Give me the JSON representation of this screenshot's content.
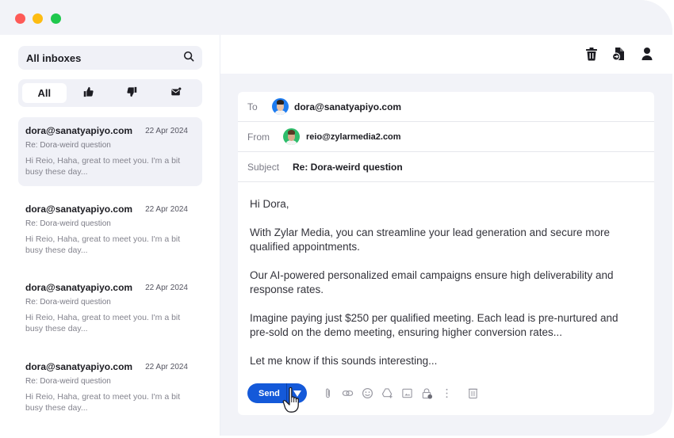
{
  "window": {
    "controls": [
      "close",
      "minimize",
      "maximize"
    ]
  },
  "sidebar": {
    "search": {
      "label": "All inboxes",
      "icon": "search-icon"
    },
    "filters": [
      {
        "label": "All",
        "icon": null,
        "active": true
      },
      {
        "label": "",
        "icon": "thumbs-up-icon",
        "active": false
      },
      {
        "label": "",
        "icon": "thumbs-down-icon",
        "active": false
      },
      {
        "label": "",
        "icon": "envelope-icon",
        "active": false
      }
    ],
    "mails": [
      {
        "from": "dora@sanatyapiyo.com",
        "date": "22 Apr 2024",
        "subject": "Re: Dora-weird question",
        "preview": "Hi Reio, Haha, great to meet you. I'm a bit busy these day...",
        "selected": true
      },
      {
        "from": "dora@sanatyapiyo.com",
        "date": "22 Apr 2024",
        "subject": "Re: Dora-weird question",
        "preview": "Hi Reio, Haha, great to meet you. I'm a bit busy these day...",
        "selected": false
      },
      {
        "from": "dora@sanatyapiyo.com",
        "date": "22 Apr 2024",
        "subject": "Re: Dora-weird question",
        "preview": "Hi Reio, Haha, great to meet you. I'm a bit busy these day...",
        "selected": false
      },
      {
        "from": "dora@sanatyapiyo.com",
        "date": "22 Apr 2024",
        "subject": "Re: Dora-weird question",
        "preview": "Hi Reio, Haha, great to meet you. I'm a bit busy these day...",
        "selected": false
      }
    ]
  },
  "header": {
    "icons": [
      "trash-icon",
      "file-forward-icon",
      "user-icon"
    ]
  },
  "compose": {
    "to_label": "To",
    "to_value": "dora@sanatyapiyo.com",
    "from_label": "From",
    "from_value": "reio@zylarmedia2.com",
    "subject_label": "Subject",
    "subject_value": "Re: Dora-weird question",
    "body": [
      "Hi Dora,",
      "With Zylar Media, you can streamline your lead generation and secure more qualified appointments.",
      "Our AI-powered personalized email campaigns ensure high deliverability and response rates.",
      "Imagine paying just $250 per qualified meeting. Each lead is pre-nurtured and pre-sold on the demo meeting, ensuring higher conversion rates...",
      "Let me know if this sounds interesting..."
    ],
    "send_label": "Send",
    "toolbar_icons": [
      "attachment-icon",
      "link-icon",
      "emoji-icon",
      "drive-icon",
      "image-icon",
      "confidential-lock-icon",
      "more-options-icon",
      "delete-draft-icon"
    ]
  },
  "colors": {
    "accent": "#1459d9",
    "background": "#f2f3f8",
    "close": "#fe5a57",
    "minimize": "#fdbc12",
    "maximize": "#1fc84d"
  }
}
